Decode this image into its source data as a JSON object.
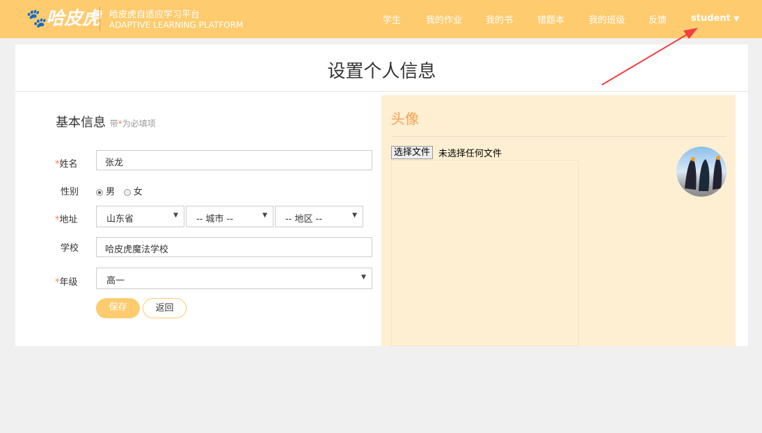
{
  "header": {
    "logo": "哈皮虎",
    "brand_title": "哈皮虎自适应学习平台",
    "brand_subtitle": "ADAPTIVE LEARNING PLATFORM",
    "nav": [
      "学生",
      "我的作业",
      "我的书",
      "错题本",
      "我的班级",
      "反馈"
    ],
    "user": "student",
    "bg_color": "#fecb6e"
  },
  "page": {
    "title": "设置个人信息"
  },
  "form": {
    "section_title": "基本信息",
    "section_hint_prefix": "带",
    "required_mark": "*",
    "section_hint_suffix": "为必填项",
    "name_label": "姓名",
    "name_value": "张龙",
    "gender_label": "性别",
    "gender_options": [
      "男",
      "女"
    ],
    "gender_selected": "男",
    "address_label": "地址",
    "province": "山东省",
    "city": "-- 城市 --",
    "district": "-- 地区 --",
    "school_label": "学校",
    "school_value": "哈皮虎魔法学校",
    "grade_label": "年级",
    "grade_value": "高一",
    "save": "保存",
    "back": "返回"
  },
  "avatar": {
    "title": "头像",
    "choose_file": "选择文件",
    "no_file": "未选择任何文件"
  }
}
